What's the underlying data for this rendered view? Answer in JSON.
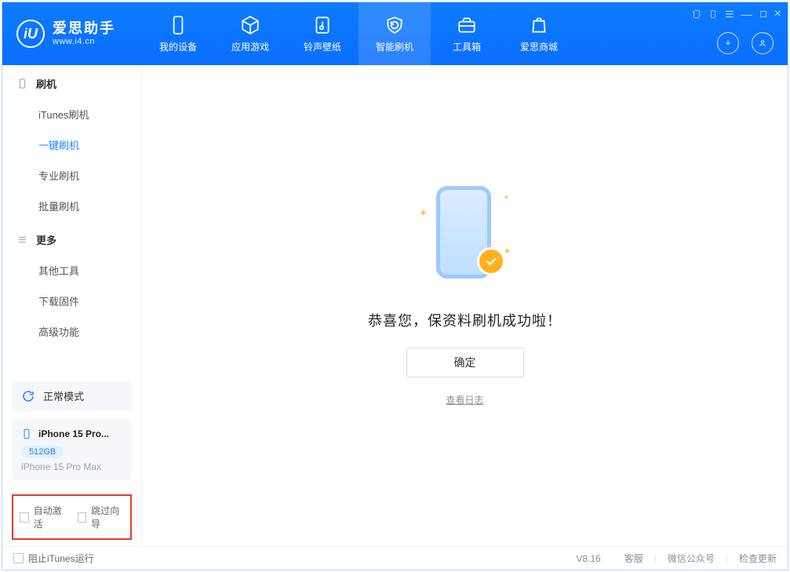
{
  "brand": {
    "title": "爱思助手",
    "subtitle": "www.i4.cn",
    "logo_text": "iU"
  },
  "topnav": [
    {
      "label": "我的设备",
      "icon": "phone"
    },
    {
      "label": "应用游戏",
      "icon": "cube"
    },
    {
      "label": "铃声壁纸",
      "icon": "music"
    },
    {
      "label": "智能刷机",
      "icon": "refresh",
      "active": true
    },
    {
      "label": "工具箱",
      "icon": "toolbox"
    },
    {
      "label": "爱思商城",
      "icon": "bag"
    }
  ],
  "sidebar": {
    "group1": {
      "title": "刷机",
      "items": [
        "iTunes刷机",
        "一键刷机",
        "专业刷机",
        "批量刷机"
      ],
      "active_index": 1
    },
    "group2": {
      "title": "更多",
      "items": [
        "其他工具",
        "下载固件",
        "高级功能"
      ]
    }
  },
  "mode": {
    "label": "正常模式"
  },
  "device": {
    "name": "iPhone 15 Pro...",
    "storage": "512GB",
    "model": "iPhone 15 Pro Max"
  },
  "side_checks": {
    "auto_activate": "自动激活",
    "skip_wizard": "跳过向导"
  },
  "main": {
    "success": "恭喜您，保资料刷机成功啦！",
    "ok": "确定",
    "log": "查看日志"
  },
  "footer": {
    "block_itunes": "阻止iTunes运行",
    "version": "V8.16",
    "support": "客服",
    "wechat": "微信公众号",
    "update": "检查更新"
  }
}
